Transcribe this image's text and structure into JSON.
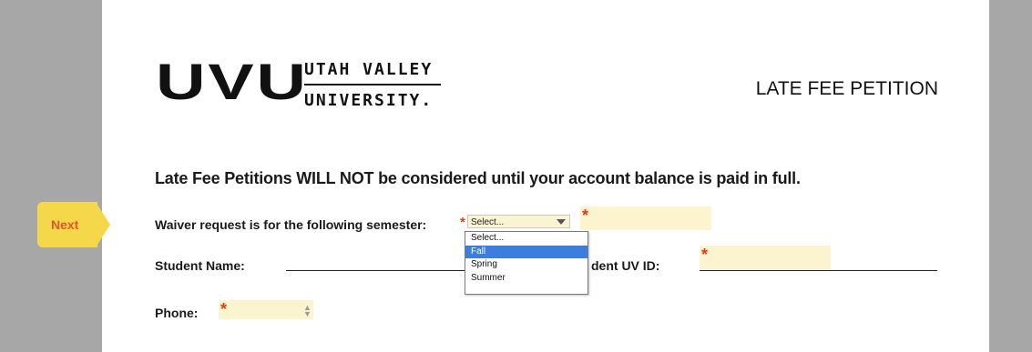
{
  "logo": {
    "mark": "UVU",
    "line1": "UTAH VALLEY",
    "line2": "UNIVERSITY."
  },
  "form": {
    "title": "LATE FEE PETITION",
    "notice": "Late Fee Petitions WILL NOT be considered until your account balance is paid in full.",
    "next_label": "Next",
    "required_marker": "*",
    "semester": {
      "label": "Waiver request is for the following semester:",
      "selected": "Select...",
      "options": [
        "Select...",
        "Fall",
        "Spring",
        "Summer"
      ],
      "highlighted": "Fall"
    },
    "student_name": {
      "label": "Student Name:",
      "value": ""
    },
    "student_id": {
      "label": "dent UV ID:",
      "value": ""
    },
    "phone": {
      "label": "Phone:",
      "value": ""
    }
  },
  "colors": {
    "side_gray": "#a7a7a7",
    "next_tab": "#f5d84a",
    "next_text": "#e2562a",
    "required_star": "#e03c10",
    "field_fill": "#fcf3cf",
    "dropdown_highlight": "#3d7de0"
  }
}
